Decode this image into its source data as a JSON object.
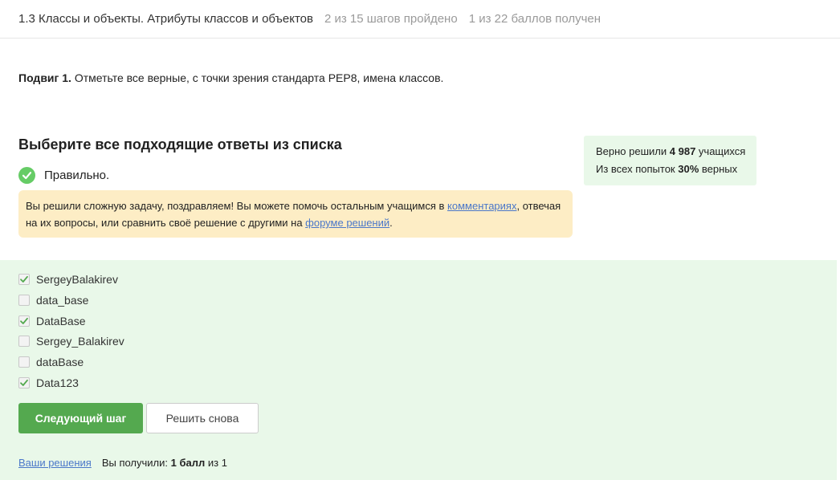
{
  "header": {
    "lesson_title": "1.3 Классы и объекты. Атрибуты классов и объектов",
    "steps_progress": "2 из 15 шагов пройдено",
    "points_progress": "1 из 22 баллов  получен"
  },
  "task": {
    "label": "Подвиг 1.",
    "text": "Отметьте все верные, с точки зрения стандарта PEP8, имена классов."
  },
  "quiz": {
    "heading": "Выберите все подходящие ответы из списка",
    "status_icon": "check-circle-icon",
    "status_text": "Правильно.",
    "status_color": "#66cc66"
  },
  "hint": {
    "text_1": "Вы решили сложную задачу, поздравляем! Вы можете помочь остальным учащимся в ",
    "link_comments": "комментариях",
    "text_2": ", отвечая на их вопросы, или сравнить своё решение с другими на ",
    "link_forum": "форуме решений",
    "text_3": "."
  },
  "stats": {
    "solved_prefix": "Верно решили ",
    "solved_count": "4 987",
    "solved_suffix": " учащихся",
    "attempts_prefix": "Из всех попыток ",
    "attempts_percent": "30%",
    "attempts_suffix": " верных"
  },
  "options": [
    {
      "label": "SergeyBalakirev",
      "checked": true
    },
    {
      "label": "data_base",
      "checked": false
    },
    {
      "label": "DataBase",
      "checked": true
    },
    {
      "label": "Sergey_Balakirev",
      "checked": false
    },
    {
      "label": "dataBase",
      "checked": false
    },
    {
      "label": "Data123",
      "checked": true
    }
  ],
  "buttons": {
    "next_step": "Следующий шаг",
    "retry": "Решить снова"
  },
  "footer": {
    "solutions_link": "Ваши решения",
    "score_prefix": "Вы получили: ",
    "score_value": "1 балл",
    "score_suffix": " из 1"
  },
  "colors": {
    "accent_green": "#54a94f",
    "answers_background": "#e9f8e9",
    "hint_background": "#fdedc5",
    "link": "#4a77c9"
  }
}
